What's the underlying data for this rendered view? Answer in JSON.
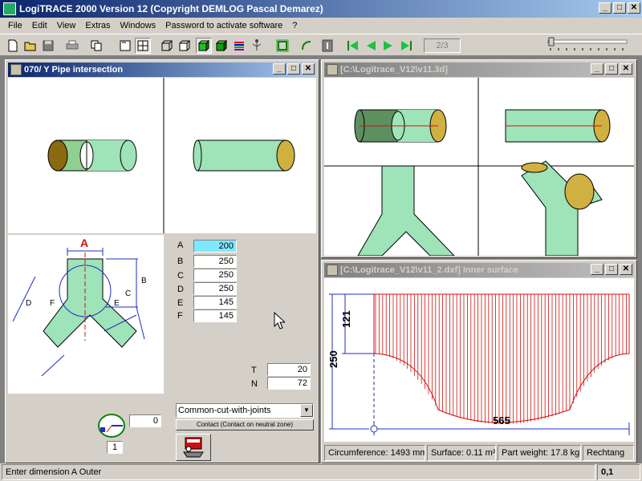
{
  "app": {
    "title": "LogiTRACE 2000  Version 12  (Copyright DEMLOG Pascal Demarez)"
  },
  "menu": [
    "File",
    "Edit",
    "View",
    "Extras",
    "Windows",
    "Password to activate software",
    "?"
  ],
  "toolbar": {
    "page_indicator": "2/3"
  },
  "window_main": {
    "title": "070/ Y Pipe intersection",
    "dimensions": [
      {
        "label": "A",
        "value": "200"
      },
      {
        "label": "B",
        "value": "250"
      },
      {
        "label": "C",
        "value": "250"
      },
      {
        "label": "D",
        "value": "250"
      },
      {
        "label": "E",
        "value": "145"
      },
      {
        "label": "F",
        "value": "145"
      }
    ],
    "t_label": "T",
    "t_value": "20",
    "n_label": "N",
    "n_value": "72",
    "angle_value": "0",
    "small_value": "1",
    "cut_option": "Common-cut-with-joints",
    "contact_button": "Contact (Contact on neutral zone)"
  },
  "window_3d": {
    "title": "[C:\\Logitrace_V12\\v11.3d]"
  },
  "window_dxf": {
    "title": "[C:\\Logitrace_V12\\v11_2.dxf]  Inner surface",
    "dim_121": "121",
    "dim_250": "250",
    "dim_565": "565",
    "status": [
      "Circumference: 1493 mm",
      "Surface: 0.11 m²",
      "Part weight: 17.8 kg",
      "Rechtang"
    ]
  },
  "statusbar": {
    "message": "Enter dimension A Outer",
    "right": "0,1"
  },
  "colors": {
    "pipe": "#9fe3b8",
    "pipe_dark": "#5d8f5f",
    "inner": "#c8a040",
    "dim_blue": "#1f2fbf",
    "dim_red": "#d01010"
  }
}
